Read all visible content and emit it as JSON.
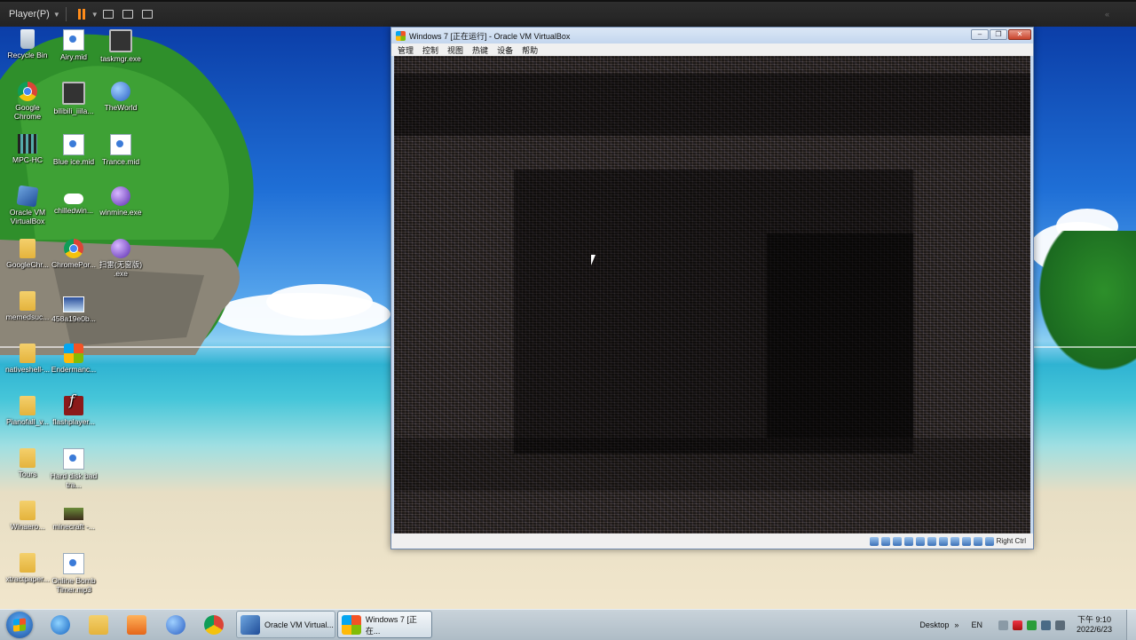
{
  "player": {
    "menu_label": "Player(P)"
  },
  "desktop": {
    "icons": [
      {
        "label": "Recycle Bin",
        "icon": "recycle-bin-icon"
      },
      {
        "label": "Airy.mid",
        "icon": "midi-file-icon"
      },
      {
        "label": "taskmgr.exe",
        "icon": "task-manager-icon"
      },
      {
        "label": "Google Chrome",
        "icon": "chrome-icon"
      },
      {
        "label": "bilibili_iiila...",
        "icon": "bilibili-icon"
      },
      {
        "label": "TheWorld",
        "icon": "theworld-browser-icon"
      },
      {
        "label": "MPC-HC",
        "icon": "mpc-hc-icon"
      },
      {
        "label": "Blue ice.mid",
        "icon": "midi-file-icon"
      },
      {
        "label": "Trance.mid",
        "icon": "midi-file-icon"
      },
      {
        "label": "Oracle VM VirtualBox",
        "icon": "virtualbox-icon"
      },
      {
        "label": "chilledwin...",
        "icon": "window-icon"
      },
      {
        "label": "winmine.exe",
        "icon": "minesweeper-icon"
      },
      {
        "label": "GoogleChr...",
        "icon": "folder-icon"
      },
      {
        "label": "ChromePor...",
        "icon": "chrome-icon"
      },
      {
        "label": "扫雷(无窗版) .exe",
        "icon": "minesweeper-icon"
      },
      {
        "label": "memedsuc...",
        "icon": "folder-icon"
      },
      {
        "label": "458a19e0b...",
        "icon": "image-file-icon"
      },
      {
        "label": "nativeshell-...",
        "icon": "folder-icon"
      },
      {
        "label": "Endermanc...",
        "icon": "windows-logo-icon"
      },
      {
        "label": "Pianofall_v...",
        "icon": "folder-icon"
      },
      {
        "label": "flashplayer...",
        "icon": "flash-player-icon"
      },
      {
        "label": "Tours",
        "icon": "folder-icon"
      },
      {
        "label": "Hard disk bad tra...",
        "icon": "document-icon"
      },
      {
        "label": "Winaero...",
        "icon": "folder-icon"
      },
      {
        "label": "minecraft -...",
        "icon": "minecraft-icon"
      },
      {
        "label": "xtractpaper...",
        "icon": "folder-icon"
      },
      {
        "label": "Online Bomb Timer.mp3",
        "icon": "audio-file-icon"
      }
    ]
  },
  "vbox": {
    "title": "Windows 7 [正在运行] - Oracle VM VirtualBox",
    "menu": [
      "管理",
      "控制",
      "视图",
      "热键",
      "设备",
      "帮助"
    ],
    "status_host_key": "Right Ctrl",
    "controls": {
      "minimize": "–",
      "restore": "❐",
      "close": "✕"
    }
  },
  "taskbar": {
    "tasks": [
      {
        "label": "Oracle VM Virtual...",
        "icon": "virtualbox-icon"
      },
      {
        "label": "Windows 7 [正在...",
        "icon": "windows7-icon"
      }
    ],
    "desktop_label": "Desktop",
    "language": "EN",
    "time": "下午 9:10",
    "date": "2022/6/23"
  }
}
